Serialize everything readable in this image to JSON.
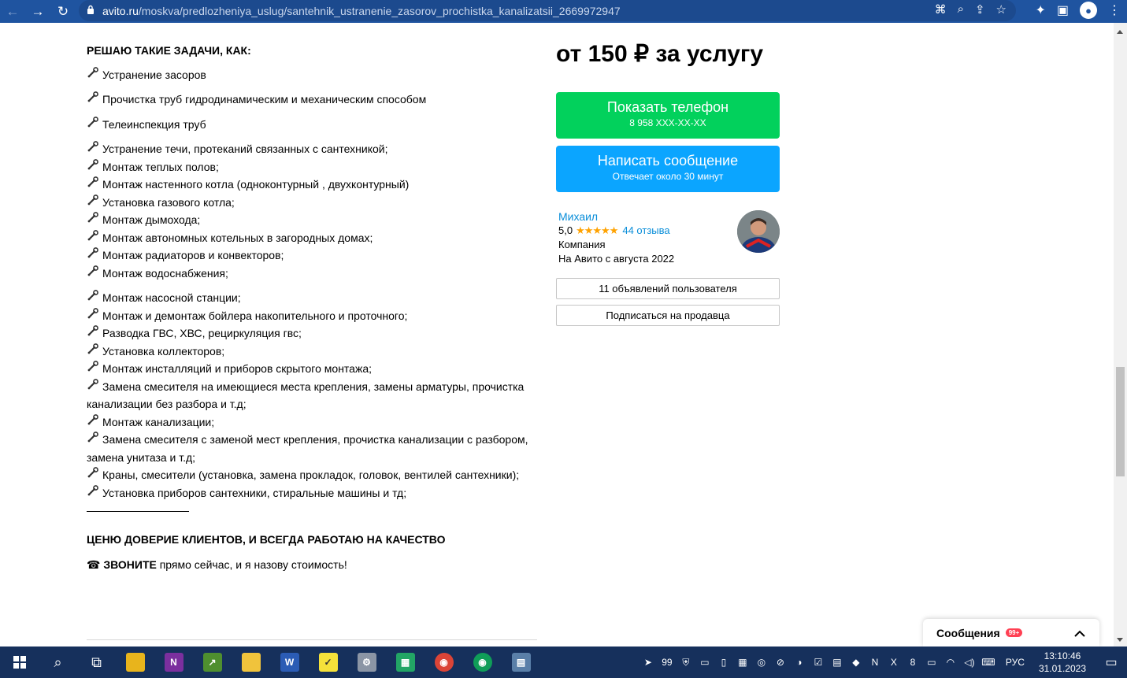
{
  "browser": {
    "url_host": "avito.ru",
    "url_path": "/moskva/predlozheniya_uslug/santehnik_ustranenie_zasorov_prochistka_kanalizatsii_2669972947"
  },
  "description": {
    "heading": "РЕШАЮ ТАКИЕ ЗАДАЧИ, КАК:",
    "groups": [
      [
        "Устранение засоров"
      ],
      [
        "Прочистка труб гидродинамическим и механическим способом"
      ],
      [
        "Телеинспекция труб"
      ],
      [
        "Устранение течи, протеканий связанных с сантехникой;",
        "Монтаж теплых полов;",
        "Монтаж настенного котла (одноконтурный , двухконтурный)",
        "Установка газового котла;",
        "Монтаж дымохода;",
        "Монтаж автономных котельных в загородных домах;",
        "Монтаж радиаторов и конвекторов;",
        "Монтаж водоснабжения;"
      ],
      [
        "Монтаж насосной станции;",
        "Монтаж и демонтаж бойлера накопительного и проточного;",
        "Разводка ГВС, ХВС, рециркуляция гвс;",
        "Установка коллекторов;",
        "Монтаж инсталляций и приборов скрытого монтажа;",
        "Замена смесителя на имеющиеся места крепления, замены арматуры, прочистка канализации без разбора и т.д;",
        "Монтаж канализации;",
        "Замена смесителя с заменой мест крепления, прочистка канализации с разбором, замена унитаза и т.д;",
        "Краны, смесители (установка, замена прокладок, головок, вентилей сантехники);",
        "Установка приборов сантехники, стиральные машины и тд;"
      ]
    ],
    "separator": "____________________",
    "heading2": "ЦЕНЮ ДОВЕРИЕ КЛИЕНТОВ, И ВСЕГДА РАБОТАЮ НА КАЧЕСТВО",
    "call_icon": "☎",
    "call_bold": "ЗВОНИТЕ",
    "call_rest": " прямо сейчас, и я назову стоимость!"
  },
  "sidebar": {
    "price": "от 150 ₽ за услугу",
    "phone_button": {
      "label": "Показать телефон",
      "sub": "8 958 XXX-XX-XX"
    },
    "message_button": {
      "label": "Написать сообщение",
      "sub": "Отвечает около 30 минут"
    },
    "seller": {
      "name": "Михаил",
      "rating": "5,0",
      "stars": "★★★★★",
      "reviews": "44 отзыва",
      "type": "Компания",
      "since": "На Авито с августа 2022"
    },
    "listings_button": "11 объявлений пользователя",
    "subscribe_button": "Подписаться на продавца"
  },
  "messenger": {
    "label": "Сообщения",
    "badge": "99+"
  },
  "taskbar": {
    "lang": "РУС",
    "time": "13:10:46",
    "date": "31.01.2023",
    "tray_badge": "99"
  },
  "colors": {
    "phone_green": "#02d15c",
    "message_blue": "#0ba5ff",
    "link_blue": "#0a8ed9",
    "star_orange": "#ffa200",
    "chrome_blue": "#1f54a0"
  }
}
